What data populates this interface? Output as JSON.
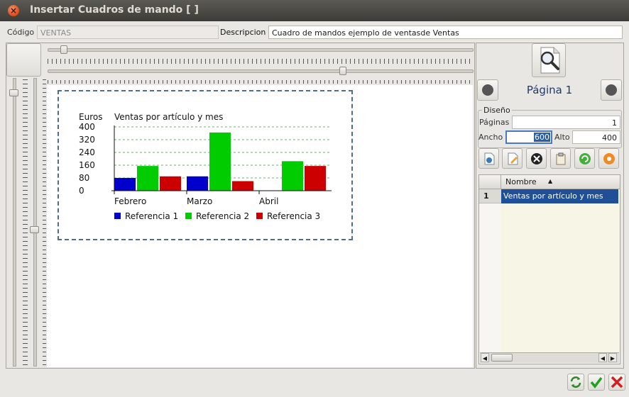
{
  "window": {
    "title": "Insertar Cuadros de mando [  ]"
  },
  "header": {
    "codigo_label": "Código",
    "codigo_value": "VENTAS",
    "descripcion_label": "Descripcion",
    "descripcion_value": "Cuadro de mandos ejemplo de ventasde Ventas"
  },
  "design": {
    "page_label": "Página 1",
    "section_label": "Diseño",
    "paginas_label": "Páginas",
    "paginas_value": "1",
    "ancho_label": "Ancho",
    "ancho_value": "600",
    "alto_label": "Alto",
    "alto_value": "400"
  },
  "list": {
    "header_nombre": "Nombre",
    "rows": [
      {
        "index": "1",
        "nombre": "Ventas por artículo y mes"
      }
    ]
  },
  "colors": {
    "ref1": "#0000cc",
    "ref2": "#00cc00",
    "ref3": "#cc0000",
    "selection": "#1f4f96"
  },
  "chart_data": {
    "type": "bar",
    "title": "Ventas por artículo y mes",
    "ylabel": "Euros",
    "xlabel": "",
    "categories": [
      "Febrero",
      "Marzo",
      "Abril"
    ],
    "yticks": [
      "400",
      "320",
      "240",
      "160",
      "80",
      "0"
    ],
    "ylim": [
      0,
      400
    ],
    "grid": true,
    "legend_position": "bottom",
    "series": [
      {
        "name": "Referencia 1",
        "values": [
          80,
          90,
          0
        ]
      },
      {
        "name": "Referencia 2",
        "values": [
          155,
          365,
          185
        ]
      },
      {
        "name": "Referencia 3",
        "values": [
          90,
          60,
          155
        ]
      }
    ]
  }
}
